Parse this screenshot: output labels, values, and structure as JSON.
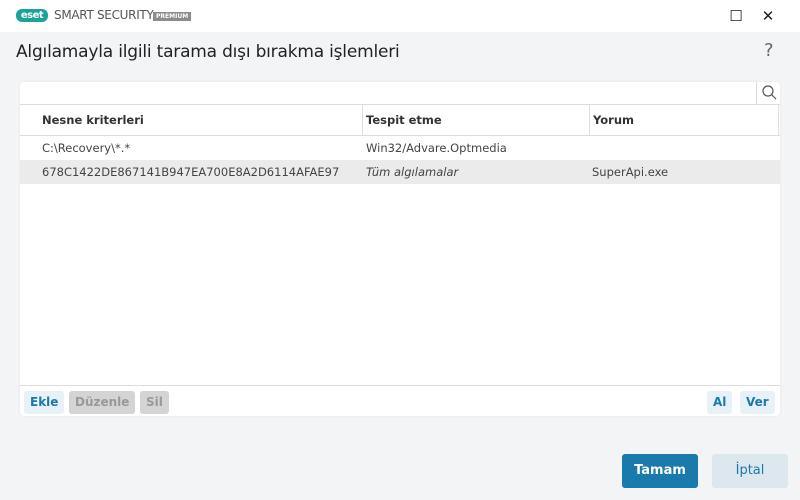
{
  "app": {
    "logo": "eset",
    "product": "SMART SECURITY",
    "edition": "PREMIUM"
  },
  "window": {
    "minimize": "—",
    "maximize": "☐",
    "close": "✕"
  },
  "dialog": {
    "title": "Algılamayla ilgili tarama dışı bırakma işlemleri",
    "help": "?"
  },
  "table": {
    "columns": [
      "Nesne kriterleri",
      "Tespit etme",
      "Yorum"
    ],
    "rows": [
      {
        "object": "C:\\Recovery\\*.*",
        "detection": "Win32/Advare.Optmedia",
        "comment": ""
      },
      {
        "object": "678C1422DE867141B947EA700E8A2D6114AFAE97",
        "detection": "Tüm algılamalar",
        "comment": "SuperApi.exe",
        "selected": true
      }
    ]
  },
  "toolbar": {
    "add": "Ekle",
    "edit": "Düzenle",
    "delete": "Sil",
    "import": "Al",
    "export": "Ver"
  },
  "buttons": {
    "ok": "Tamam",
    "cancel": "İptal"
  },
  "colors": {
    "accent": "#1a7aab",
    "brand": "#1aa39a"
  }
}
